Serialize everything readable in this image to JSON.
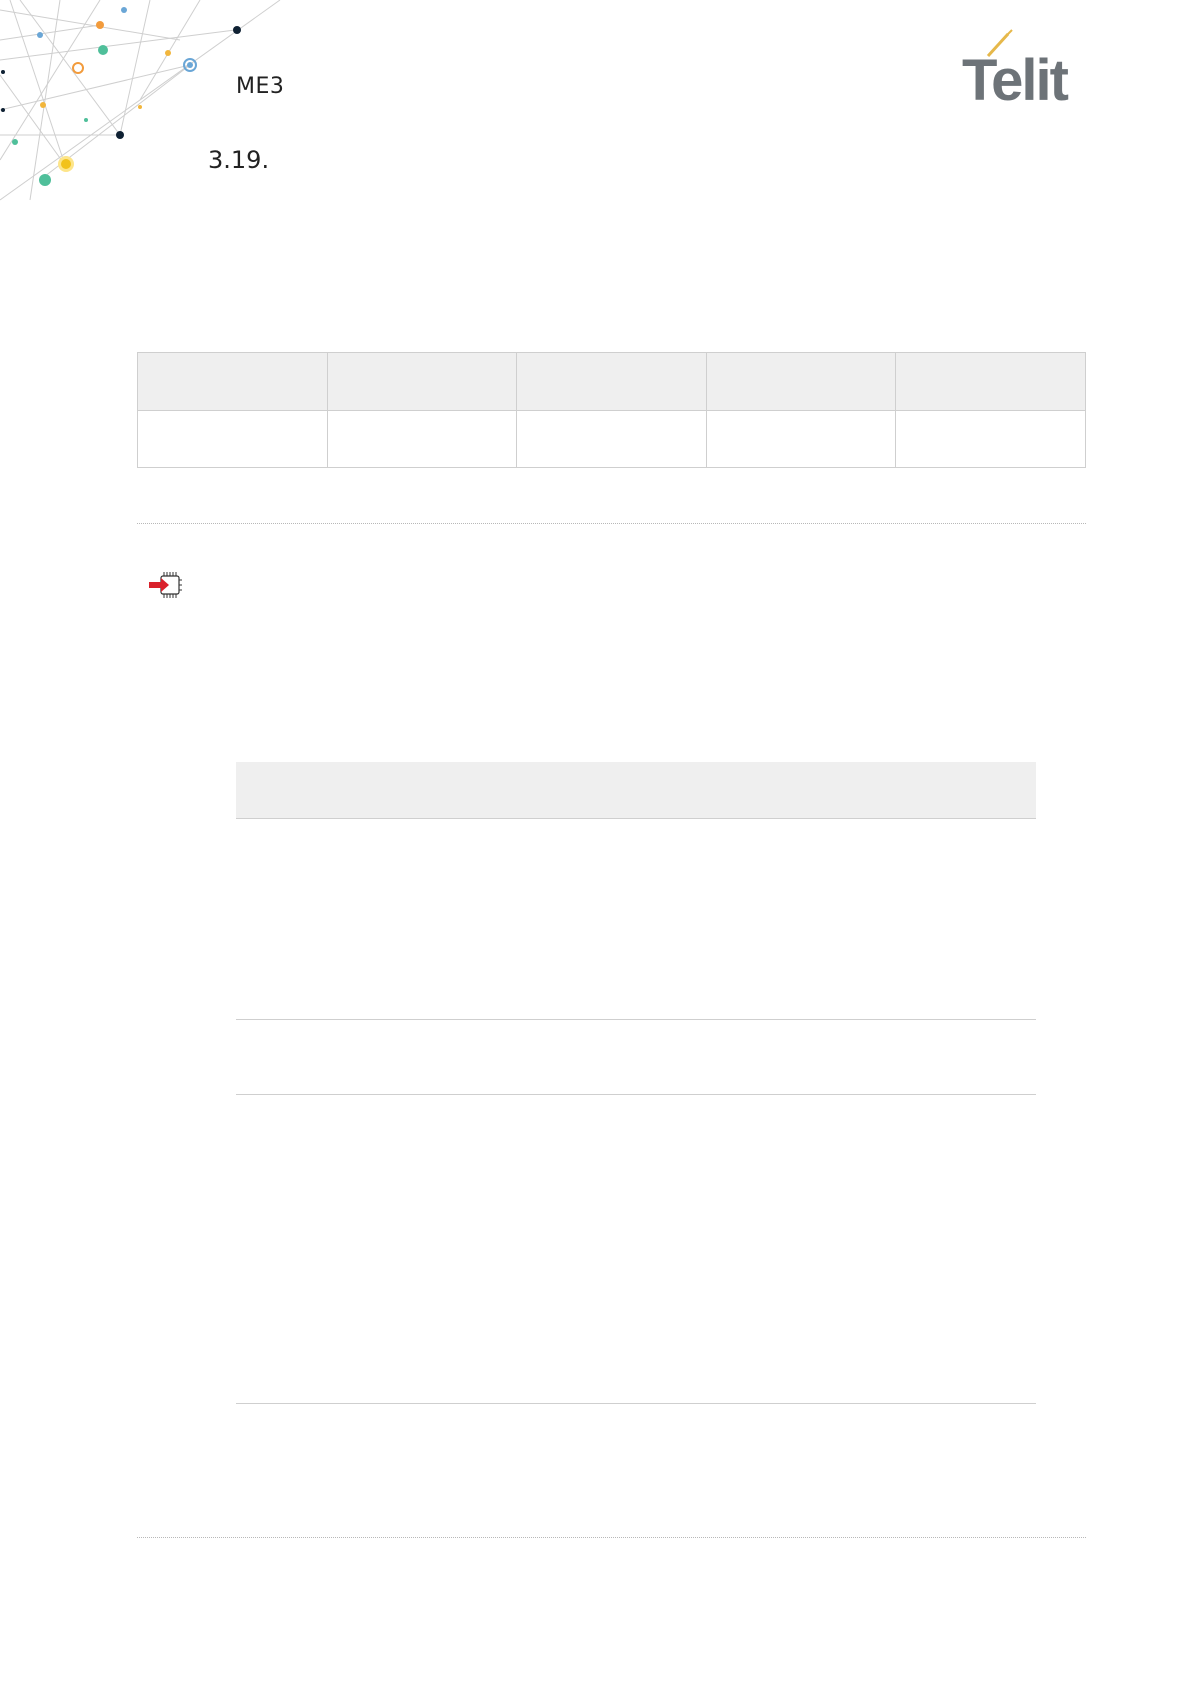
{
  "header": {
    "product": "ME3",
    "section_number": "3.19."
  },
  "logo": {
    "brand": "Telit",
    "color": "#6d7378",
    "accent": "#e6b84a"
  },
  "icons": {
    "chip": "chip-with-red-arrow-icon"
  }
}
